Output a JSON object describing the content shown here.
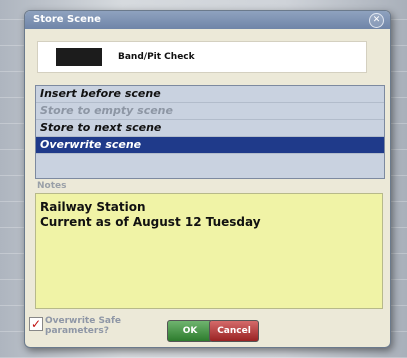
{
  "dialog": {
    "title": "Store Scene",
    "close_icon": "close-icon",
    "scene": {
      "name": "Band/Pit Check",
      "color": "#1c1c1c"
    },
    "options": [
      {
        "label": "Insert before scene",
        "state": "normal"
      },
      {
        "label": "Store to empty scene",
        "state": "disabled"
      },
      {
        "label": "Store to next scene",
        "state": "normal"
      },
      {
        "label": "Overwrite scene",
        "state": "selected"
      }
    ],
    "notes_label": "Notes",
    "notes_lines": [
      "Railway Station",
      "Current as of  August 12 Tuesday"
    ],
    "overwrite_safe_label": "Overwrite Safe parameters?",
    "overwrite_safe_checked": true,
    "ok_label": "OK",
    "cancel_label": "Cancel"
  },
  "colors": {
    "titlebar": "#7a8fb0",
    "selected_option": "#1f3a8a",
    "notes_background": "#f0f3a6",
    "ok_button": "#2d7c2d",
    "cancel_button": "#9a2323"
  }
}
